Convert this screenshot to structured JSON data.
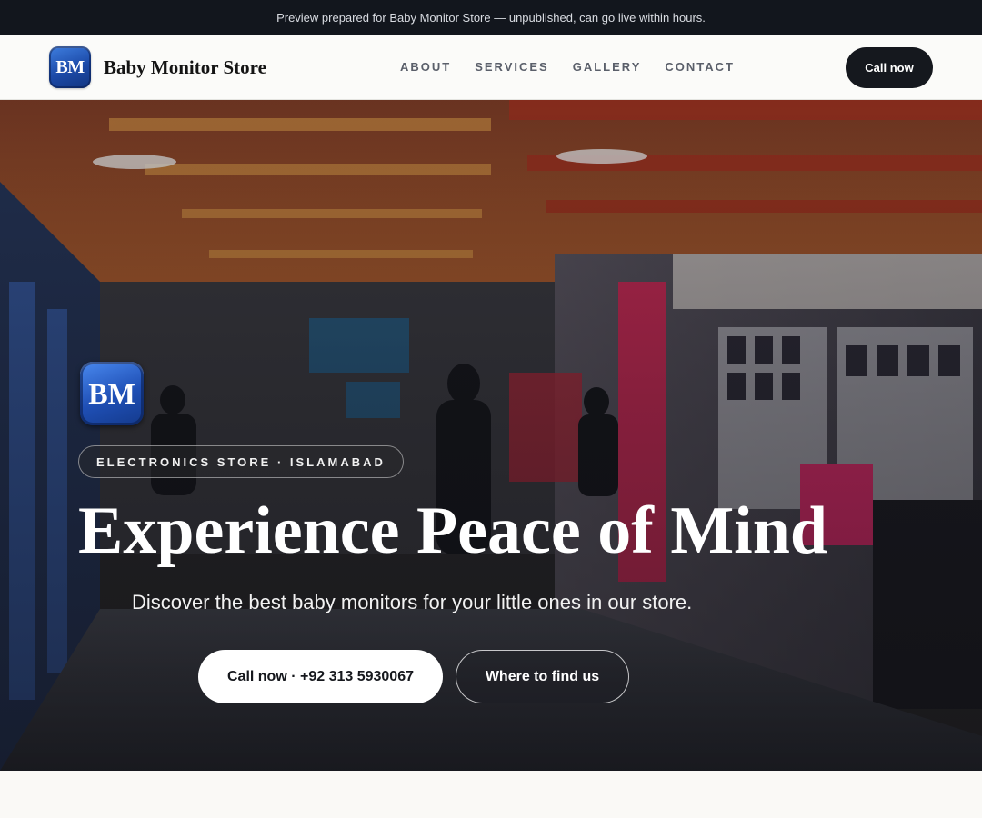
{
  "preview_banner": "Preview prepared for Baby Monitor Store — unpublished, can go live within hours.",
  "brand": {
    "monogram": "BM",
    "name": "Baby Monitor Store"
  },
  "nav": {
    "links": [
      "ABOUT",
      "SERVICES",
      "GALLERY",
      "CONTACT"
    ],
    "cta_label": "Call now"
  },
  "hero": {
    "monogram": "BM",
    "badge": "ELECTRONICS STORE · ISLAMABAD",
    "title": "Experience Peace of Mind",
    "subtitle": "Discover the best baby monitors for your little ones in our store.",
    "primary_button": "Call now · +92 313 5930067",
    "secondary_button": "Where to find us"
  },
  "colors": {
    "topbar": "#12161d",
    "cta_dark": "#15181e",
    "logo_blue": "#1c4aa8",
    "page_bg": "#faf9f6"
  }
}
